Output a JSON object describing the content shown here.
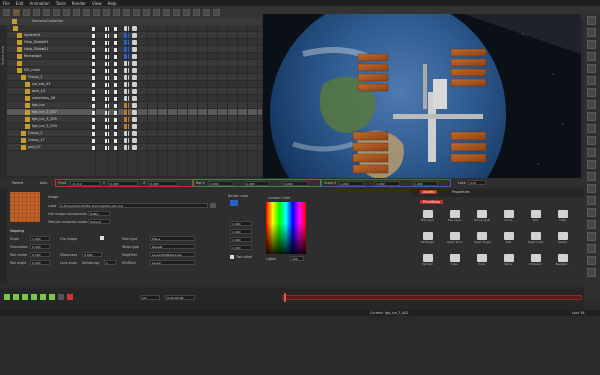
{
  "menu": [
    "File",
    "Edit",
    "Animation",
    "Tools",
    "Render",
    "View",
    "Help"
  ],
  "scene": {
    "header_title": "Sectors/Container",
    "vertical_tab": "Scene tree",
    "rows": [
      {
        "label": "",
        "indent": 0
      },
      {
        "label": "Sphere01",
        "indent": 1
      },
      {
        "label": "Halo_Globe01",
        "indent": 1
      },
      {
        "label": "Halo_Globe01",
        "indent": 1
      },
      {
        "label": "Rectangle",
        "indent": 1
      },
      {
        "label": "",
        "indent": 1
      },
      {
        "label": "ISS_main",
        "indent": 1
      },
      {
        "label": "Group_1",
        "indent": 2
      },
      {
        "label": "sol_ext_03",
        "indent": 3
      },
      {
        "label": "arm_15",
        "indent": 3
      },
      {
        "label": "columbus_06",
        "indent": 3
      },
      {
        "label": "fgb_ice",
        "indent": 3
      },
      {
        "label": "fgb_ice_2_007",
        "indent": 3
      },
      {
        "label": "fgb_ice_3_005",
        "indent": 3
      },
      {
        "label": "fgb_ice_3_004",
        "indent": 3
      },
      {
        "label": "Group_2",
        "indent": 2
      },
      {
        "label": "Group_17",
        "indent": 2
      },
      {
        "label": "pod_07",
        "indent": 2
      }
    ],
    "selected_row": 12
  },
  "tabs": {
    "parent": "Parent",
    "axis": "Axis",
    "pivot_label": "Pivot",
    "pivot_x": "-0.112",
    "y_label": "Y",
    "pivot_y": "0.000",
    "z_label": "Z",
    "pivot_z": "0.000",
    "rot_label": "Rot X",
    "rot_x": "0.000",
    "rot_y": "0.000",
    "rot_z": "0.000",
    "scale_label": "Scale X",
    "scale_x": "1.000",
    "scale_y": "1.000",
    "scale_z": "1.000",
    "lock_label": "Lock",
    "lock_value": "XYZ"
  },
  "props": {
    "image_label": "Image",
    "load_label": "Load",
    "load_path": "D:/Projects/Orbit/ISS_textures/fgb-skin.jpg",
    "use_components_label": "Use image components",
    "use_components_value": "RGBA",
    "texture_mode_label": "Texture compress mode",
    "texture_mode_value": "Default",
    "mapping_label": "Mapping",
    "scale_label": "Scale",
    "scale_value": "1.000",
    "translation_label": "Translation",
    "translation_value": "0.000",
    "roll_center_label": "Roll center",
    "roll_center_value": "0.500",
    "roll_angle_label": "Roll angle",
    "roll_angle_value": "0.000",
    "flip_image_label": "Flip image",
    "sharpness_label": "Sharpness",
    "sharpness_value": "0.000",
    "lock_scale_label": "Lock scale",
    "anisotropy_label": "Anisotropy",
    "anisotropy_value": "1",
    "map_type_label": "Map type",
    "map_type_value": "Plane",
    "wrap_type_label": "Wrap type",
    "wrap_type_value": "Repeat",
    "mag_filter_label": "MagFilter",
    "mag_filter_value": "LinearMipMapLinear",
    "min_filter_label": "MinFilter",
    "min_filter_value": "Linear",
    "border_color_label": "Border color",
    "custom_color_label": "Custom Color",
    "color_values": [
      "1.000",
      "1.000",
      "1.000",
      "1.000"
    ],
    "two_sided_label": "Two sided",
    "lights_label": "Lights",
    "lights_value": "100"
  },
  "primitives": {
    "tab_left": "Assets",
    "tab_right": "Properties",
    "subtab": "Primitives",
    "items": [
      "Flat Layer",
      "Free Layer",
      "Prerop Layer",
      "Group",
      "Text",
      "Cube",
      "Rectangle",
      "Super Torus",
      "Super fill gon",
      "Disk",
      "Super Cube",
      "Sphere",
      "Cylinder",
      "Cone",
      "Torus",
      "Spline",
      "Extrusion",
      "Bevelled..."
    ]
  },
  "timeline": {
    "frame": "1/1",
    "time": "0:00:00:00"
  },
  "status": {
    "current_label": "Current:",
    "current_value": "fgb_ice_3_002",
    "lock_fill_label": "Lock fill"
  }
}
